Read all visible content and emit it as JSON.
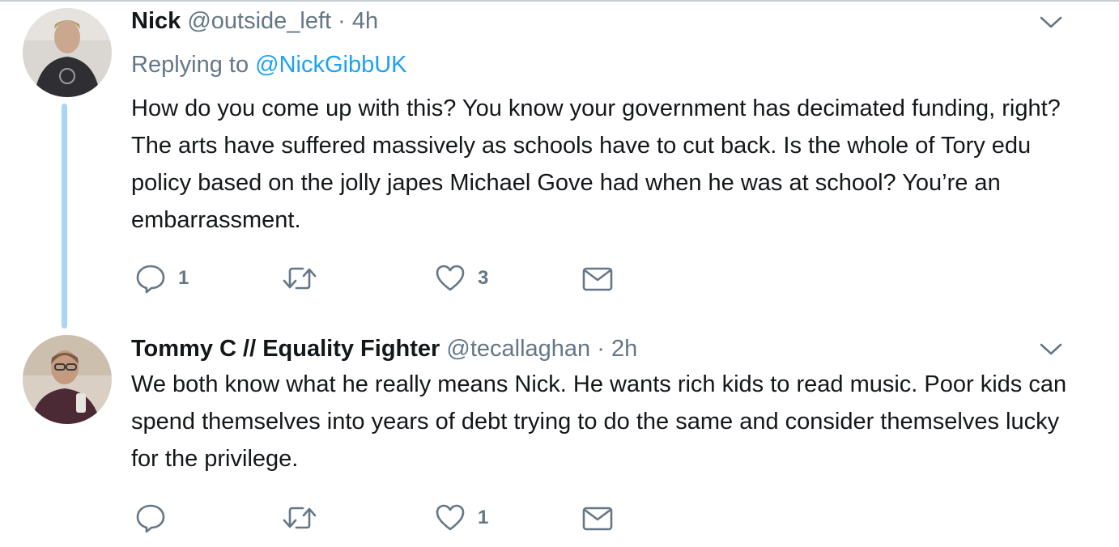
{
  "tweets": [
    {
      "display_name": "Nick",
      "handle": "@outside_left",
      "separator": "·",
      "time": "4h",
      "reply_prefix": "Replying to",
      "reply_to": "@NickGibbUK",
      "text": "How do you come up with this? You know your government has decimated funding, right? The arts have suffered massively as schools have to cut back. Is the whole of Tory edu policy based on the jolly japes Michael Gove had when he was at school? You’re an embarrassment.",
      "replies": "1",
      "retweets": "",
      "likes": "3",
      "icons": [
        "avatar",
        "chevron-down-icon",
        "reply-icon",
        "retweet-icon",
        "heart-icon",
        "envelope-icon"
      ]
    },
    {
      "display_name": "Tommy C // Equality Fighter",
      "handle": "@tecallaghan",
      "separator": "·",
      "time": "2h",
      "text": "We both know what he really means Nick. He wants rich kids to read music. Poor kids can spend themselves into years of debt trying to do the same and consider themselves lucky for the privilege.",
      "replies": "",
      "retweets": "",
      "likes": "1",
      "icons": [
        "avatar",
        "chevron-down-icon",
        "reply-icon",
        "retweet-icon",
        "heart-icon",
        "envelope-icon"
      ]
    }
  ],
  "colors": {
    "text": "#14171a",
    "secondary": "#657786",
    "link": "#1da1f2",
    "thread_line": "#a9d5f6"
  }
}
